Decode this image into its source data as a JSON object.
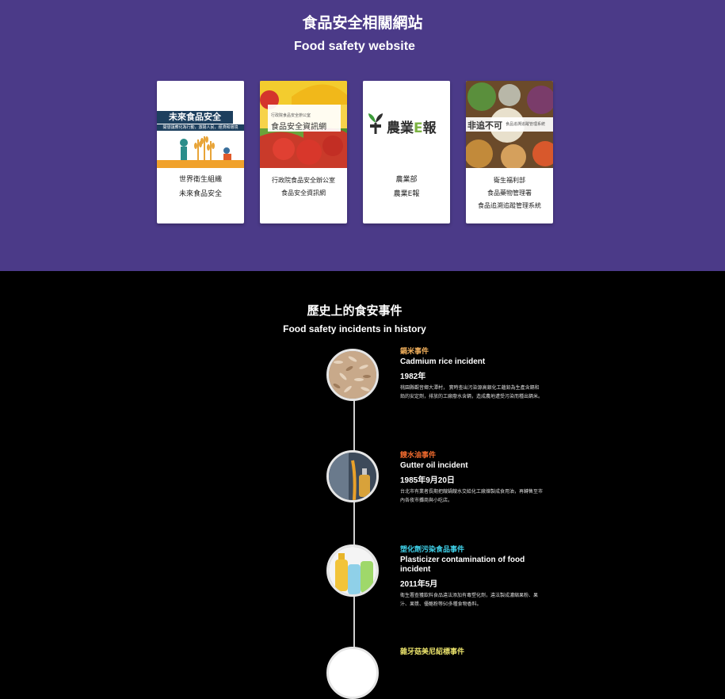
{
  "header": {
    "title_zh": "食品安全相關網站",
    "title_en": "Food safety website"
  },
  "cards": [
    {
      "image_title": "未來食品安全",
      "image_subtitle": "開發讓應化為行動，激揚人民，經濟和環境",
      "lines": [
        "世界衛生組織",
        "未來食品安全"
      ]
    },
    {
      "image_title_small": "行政院食品安全辦公室",
      "image_title": "食品安全資訊網",
      "lines": [
        "行政院食品安全辦公室",
        "食品安全資訊網"
      ]
    },
    {
      "logo_text": "農業",
      "logo_e": "E",
      "logo_bao": "報",
      "lines": [
        "農業部",
        "農業E報"
      ]
    },
    {
      "logo_text": "非追不可",
      "logo_sub": "食品追溯追蹤管理系統",
      "lines": [
        "衛生福利部",
        "食品藥物管理署",
        "食品追溯追蹤管理系統"
      ]
    }
  ],
  "history": {
    "title_zh": "歷史上的食安事件",
    "title_en": "Food safety incidents in history",
    "events": [
      {
        "title_zh": "鎘米事件",
        "title_en": "Cadmium rice incident",
        "date": "1982年",
        "desc": "桃園縣觀音鄉大潭村，  實時查出污染源高銀化工蘊鉛為生產含鎘和鉛的安定劑，排放的工廠廢水含鎘，造成農地遭受污染而種出鎘米。",
        "color": "#f2b05c"
      },
      {
        "title_zh": "餿水油事件",
        "title_en": "Gutter oil incident",
        "date": "1985年9月20日",
        "desc": "台北市有業者長期把餿鍋餿水交給化工廠煉製成食用油，再轉售至市內各夜市攤商與小吃店。",
        "color": "#f26b2e"
      },
      {
        "title_zh": "塑化劑污染食品事件",
        "title_en": "Plasticizer contamination of food incident",
        "date": "2011年5月",
        "desc": "衛生署查獲飲料食品違法添加有毒塑化劑，違法製成濃縮果粉、果汁、果漿、優酪粉等50多種食物香料。",
        "color": "#3fd0e8"
      },
      {
        "title_zh": "雜牙菇美尼紹標事件",
        "color": "#e8e06a"
      }
    ]
  }
}
